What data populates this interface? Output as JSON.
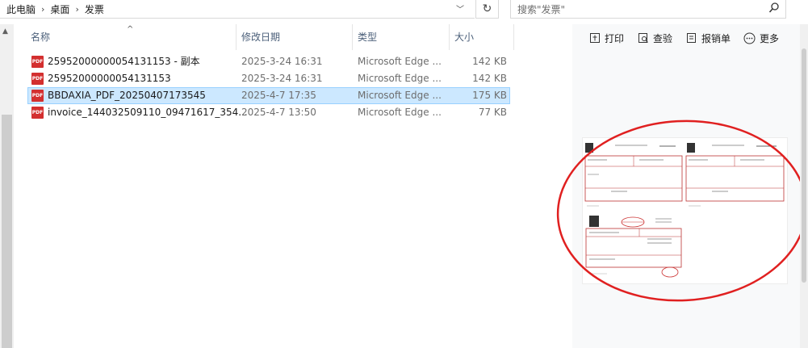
{
  "address": {
    "crumbs": [
      "此电脑",
      "桌面",
      "发票"
    ]
  },
  "search": {
    "placeholder": "搜索\"发票\""
  },
  "columns": {
    "name": "名称",
    "date": "修改日期",
    "type": "类型",
    "size": "大小"
  },
  "files": [
    {
      "name": "25952000000054131153 - 副本",
      "date": "2025-3-24 16:31",
      "type": "Microsoft Edge ...",
      "size": "142 KB",
      "icon": "pdf-icon",
      "selected": false
    },
    {
      "name": "25952000000054131153",
      "date": "2025-3-24 16:31",
      "type": "Microsoft Edge ...",
      "size": "142 KB",
      "icon": "pdf-icon",
      "selected": false
    },
    {
      "name": "BBDAXIA_PDF_20250407173545",
      "date": "2025-4-7 17:35",
      "type": "Microsoft Edge ...",
      "size": "175 KB",
      "icon": "pdf-icon",
      "selected": true
    },
    {
      "name": "invoice_144032509110_09471617_354...",
      "date": "2025-4-7 13:50",
      "type": "Microsoft Edge ...",
      "size": "77 KB",
      "icon": "pdf-icon",
      "selected": false
    }
  ],
  "preview": {
    "toolbar": {
      "print": "打印",
      "check": "查验",
      "report": "报销单",
      "more": "更多"
    },
    "annotation_color": "#e02020"
  },
  "colors": {
    "selection_bg": "#cce8ff",
    "selection_border": "#99d1ff",
    "pdf_icon": "#d32f2f"
  }
}
